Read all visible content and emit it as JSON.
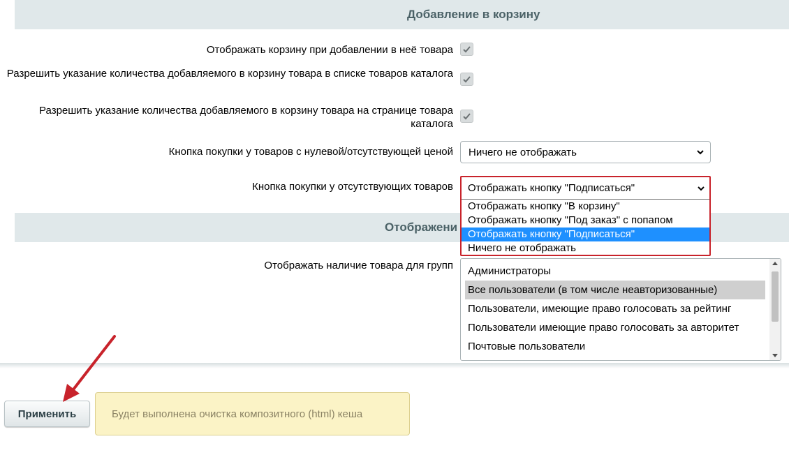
{
  "sections": {
    "add_to_cart": "Добавление в корзину",
    "display": "Отображени"
  },
  "rows": {
    "show_cart": "Отображать корзину при добавлении в неё товара",
    "qty_list": "Разрешить указание количества добавляемого в корзину товара в списке товаров каталога",
    "qty_page": "Разрешить указание количества добавляемого в корзину товара на странице товара каталога",
    "zero_price": "Кнопка покупки у товаров с нулевой/отсутствующей ценой",
    "absent": "Кнопка покупки у отсутствующих товаров",
    "groups": "Отображать наличие товара для групп"
  },
  "checkboxes": {
    "show_cart": true,
    "qty_list": true,
    "qty_page": true
  },
  "zero_price_select": {
    "value": "Ничего не отображать"
  },
  "absent_select": {
    "value": "Отображать кнопку \"Подписаться\"",
    "options": [
      "Отображать кнопку \"В корзину\"",
      "Отображать кнопку \"Под заказ\" с попапом",
      "Отображать кнопку \"Подписаться\"",
      "Ничего не отображать"
    ],
    "selected_index": 2
  },
  "groups_list": {
    "items": [
      "Администраторы",
      "Все пользователи (в том числе неавторизованные)",
      "Пользователи, имеющие право голосовать за рейтинг",
      "Пользователи имеющие право голосовать за авторитет",
      "Почтовые пользователи"
    ],
    "highlighted_index": 1
  },
  "footer": {
    "apply_label": "Применить",
    "notice": "Будет выполнена очистка композитного (html) кеша"
  },
  "colors": {
    "accent_red": "#c8232b",
    "selection_blue": "#1e90ff",
    "section_bg": "#e0e8ea"
  }
}
